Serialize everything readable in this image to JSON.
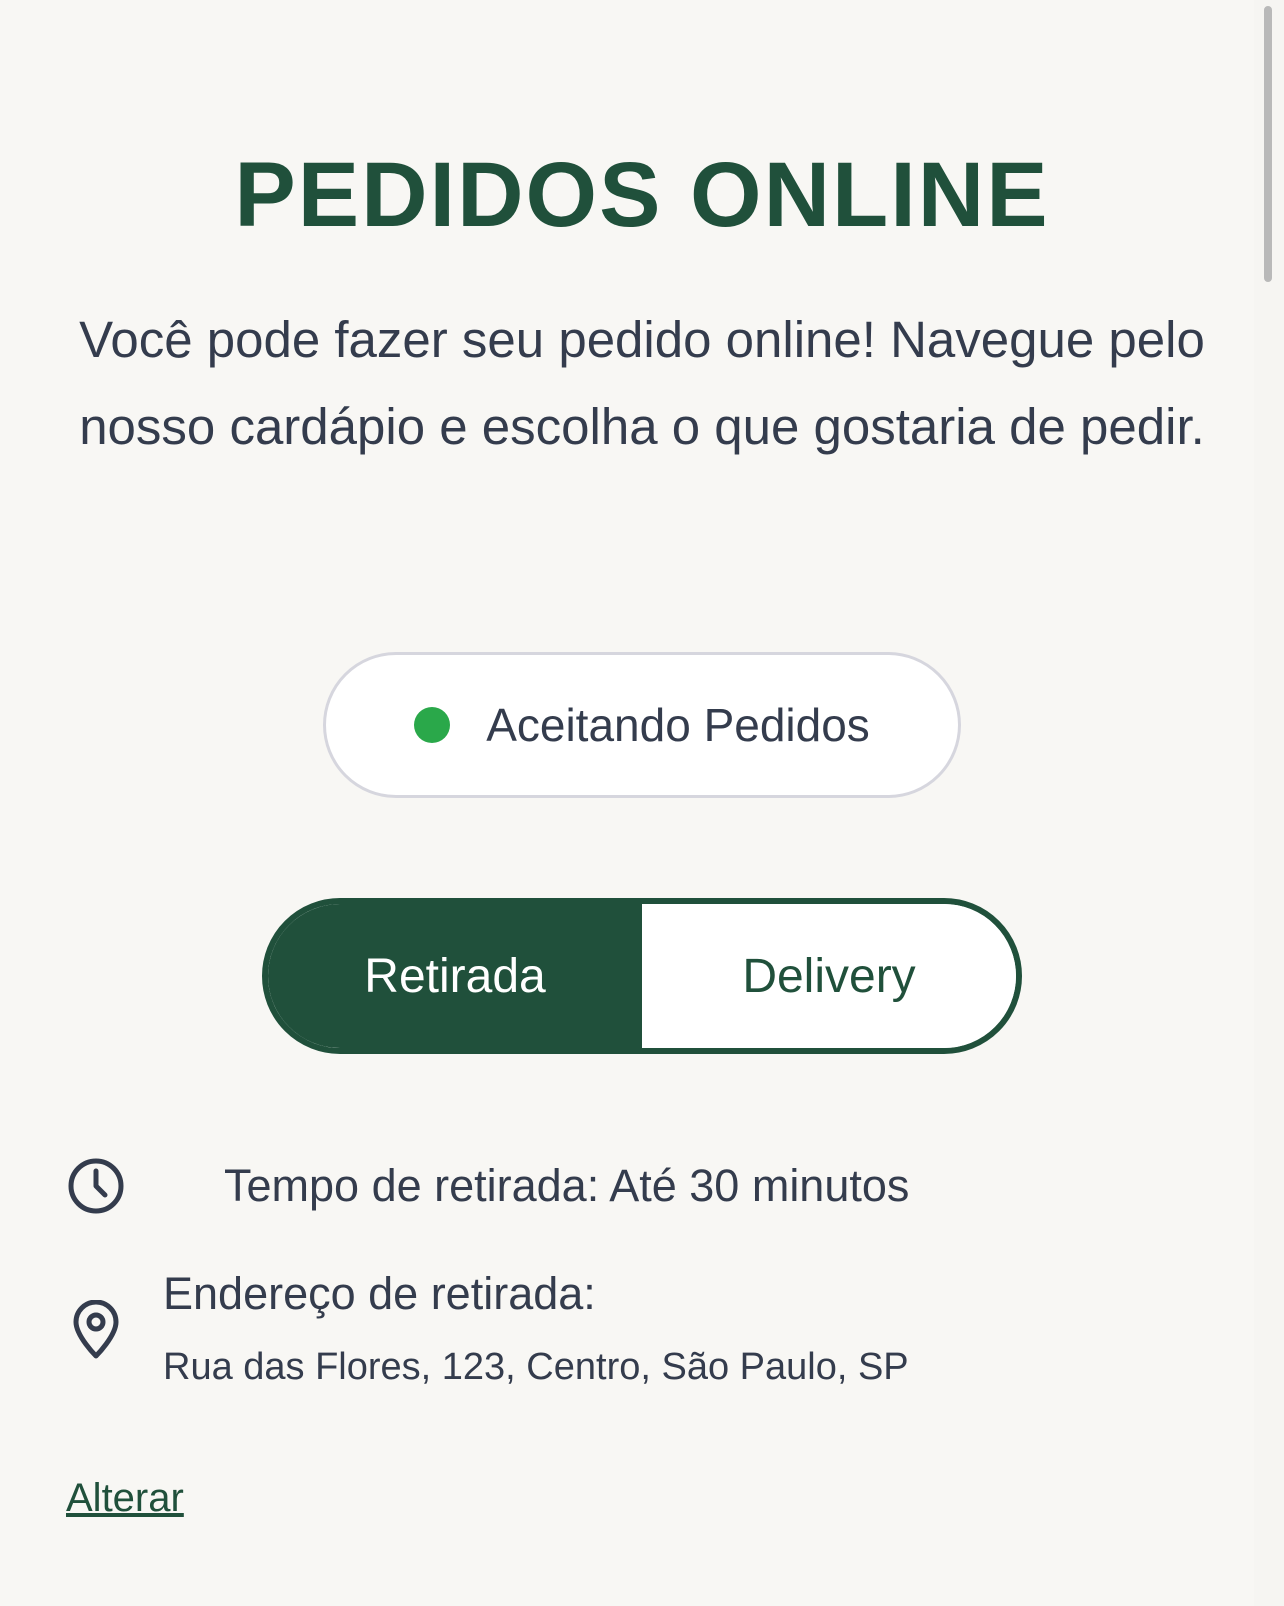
{
  "header": {
    "title": "PEDIDOS ONLINE",
    "description": "Você pode fazer seu pedido online! Navegue pelo nosso cardápio e escolha o que gostaria de pedir."
  },
  "status": {
    "label": "Aceitando Pedidos",
    "color": "#2aa84a"
  },
  "mode_toggle": {
    "options": [
      {
        "label": "Retirada",
        "active": true
      },
      {
        "label": "Delivery",
        "active": false
      }
    ]
  },
  "pickup_info": {
    "time_icon": "clock-icon",
    "time_text": "Tempo de retirada: Até 30 minutos",
    "address_icon": "map-pin-icon",
    "address_label": "Endereço de retirada:",
    "address_value": "Rua das Flores, 123, Centro, São Paulo, SP"
  },
  "actions": {
    "change_label": "Alterar"
  },
  "colors": {
    "brand": "#20503b",
    "text": "#343c4d",
    "background": "#f8f7f4"
  }
}
